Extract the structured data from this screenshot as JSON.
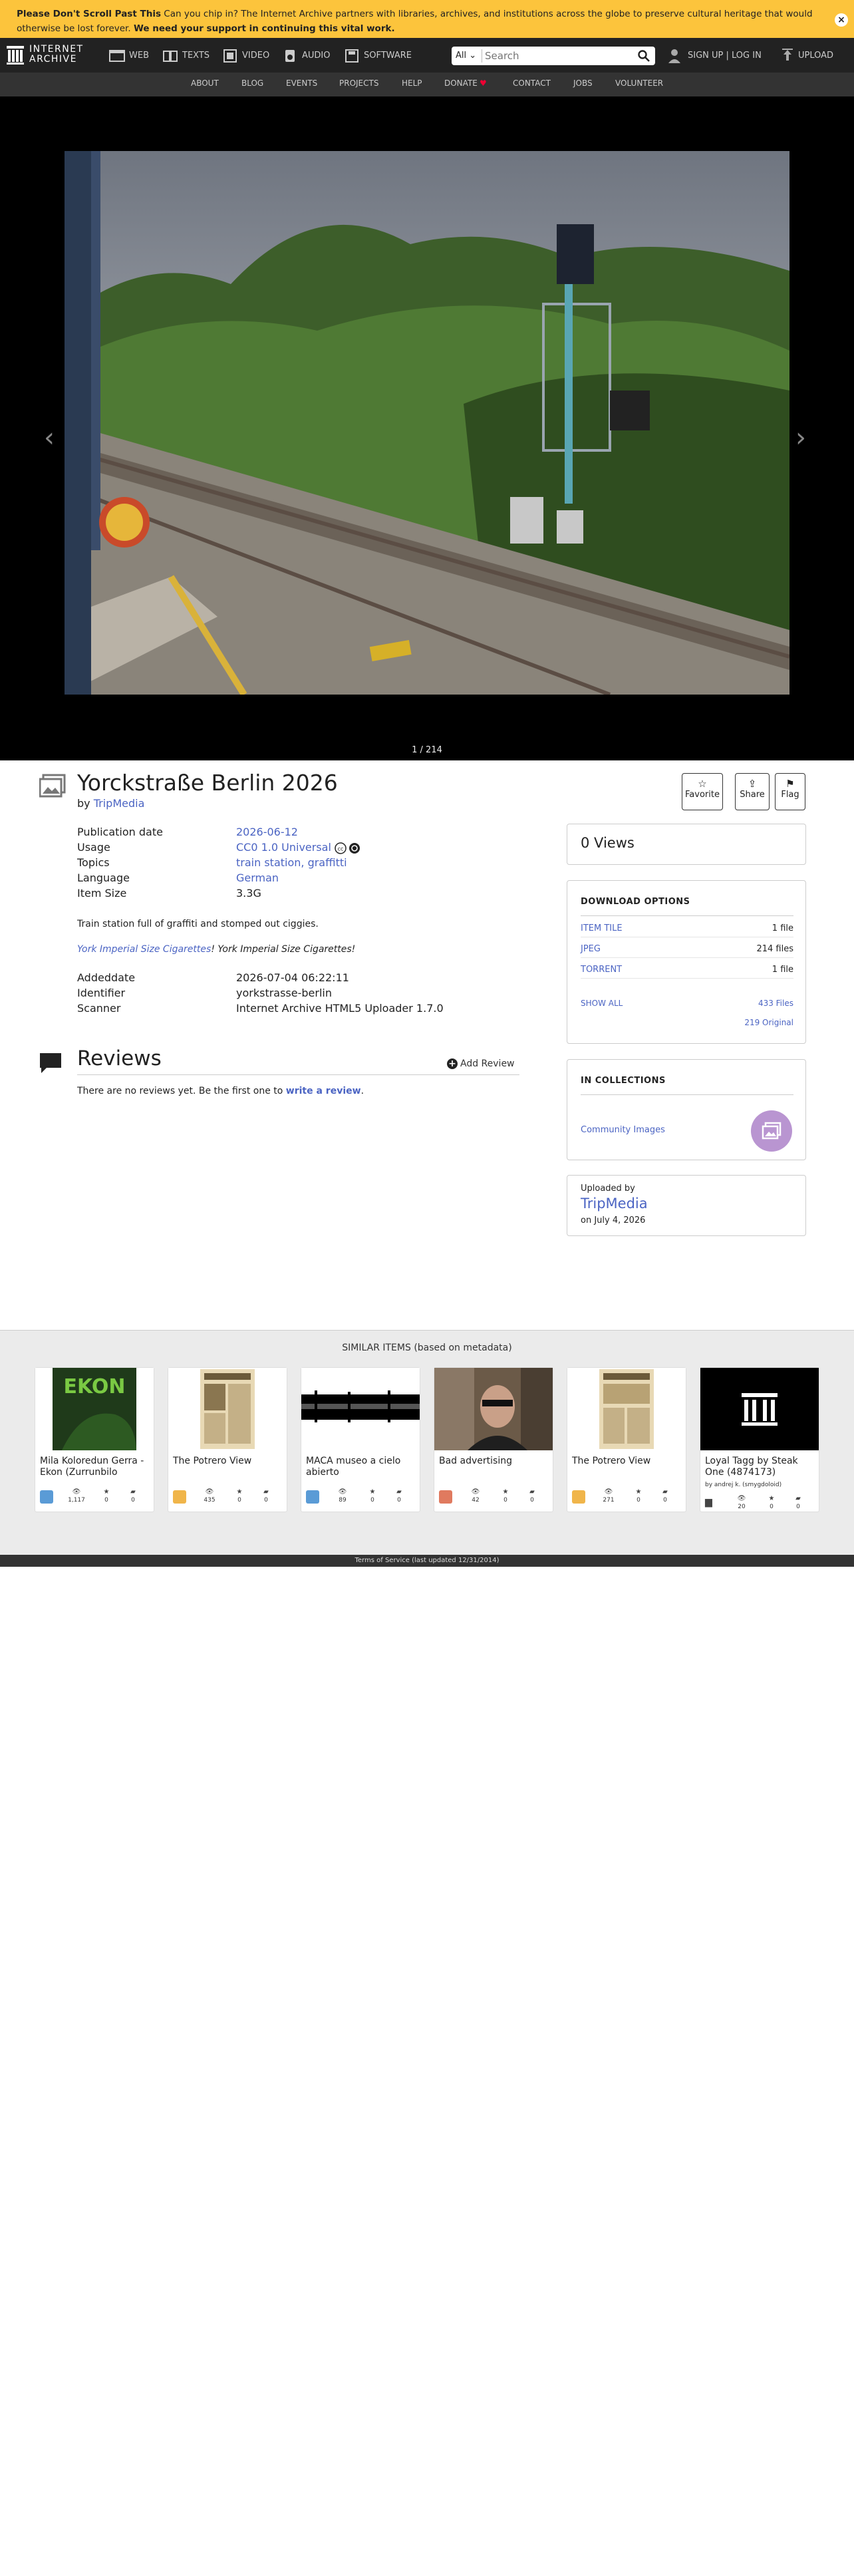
{
  "banner": {
    "bold_lead": "Please Don't Scroll Past This",
    "message": "Can you chip in? The Internet Archive partners with libraries, archives, and institutions across the globe to preserve cultural heritage that would otherwise be lost forever.",
    "bold_tail": "We need your support in continuing this vital work.",
    "close": "×"
  },
  "topnav": {
    "logo_line1": "INTERNET",
    "logo_line2": "ARCHIVE",
    "tabs": [
      "WEB",
      "TEXTS",
      "VIDEO",
      "AUDIO",
      "SOFTWARE"
    ],
    "search_scope": "All",
    "search_placeholder": "Search",
    "signup": "SIGN UP | LOG IN",
    "upload": "UPLOAD"
  },
  "subnav": [
    "ABOUT",
    "BLOG",
    "EVENTS",
    "PROJECTS",
    "HELP",
    "DONATE",
    "CONTACT",
    "JOBS",
    "VOLUNTEER"
  ],
  "theater": {
    "prev": "‹",
    "next": "›",
    "page_count": "1 / 214"
  },
  "item": {
    "title": "Yorckstraße Berlin 2026",
    "by_prefix": "by",
    "creator": "TripMedia",
    "actions": [
      {
        "glyph": "☆",
        "label": "Favorite"
      },
      {
        "glyph": "⇪",
        "label": "Share"
      },
      {
        "glyph": "⚑",
        "label": "Flag"
      }
    ],
    "meta": [
      {
        "key": "Publication date",
        "value": "2026-06-12"
      },
      {
        "key": "Usage",
        "value": "CC0 1.0 Universal"
      },
      {
        "key": "Topics",
        "value": "train station, graffitti"
      },
      {
        "key": "Language",
        "value": "German"
      },
      {
        "key": "Item Size",
        "value": "3.3G"
      }
    ],
    "description": "Train station full of graffiti and stomped out ciggies.",
    "quote_link": "York Imperial Size Cigarettes",
    "quote_rest": "! York Imperial Size Cigarettes!",
    "meta2": [
      {
        "key": "Addeddate",
        "value": "2026-07-04 06:22:11"
      },
      {
        "key": "Identifier",
        "value": "yorkstrasse-berlin"
      },
      {
        "key": "Scanner",
        "value": "Internet Archive HTML5 Uploader 1.7.0"
      }
    ]
  },
  "reviews": {
    "heading": "Reviews",
    "add": "Add Review",
    "empty_prefix": "There are no reviews yet. Be the first one to",
    "empty_link": "write a review",
    "empty_suffix": "."
  },
  "sidebar": {
    "views": "0 Views",
    "download_heading": "DOWNLOAD OPTIONS",
    "downloads": [
      {
        "label": "ITEM TILE",
        "count": "1 file"
      },
      {
        "label": "JPEG",
        "count": "214 files"
      },
      {
        "label": "TORRENT",
        "count": "1 file"
      }
    ],
    "show_all": "SHOW ALL",
    "files_total": "433 Files",
    "files_original": "219 Original",
    "collections_heading": "IN COLLECTIONS",
    "collection": "Community Images",
    "uploaded_by": "Uploaded by",
    "uploader": "TripMedia",
    "uploaded_on": "on July 4, 2026"
  },
  "similar": {
    "heading": "SIMILAR ITEMS (based on metadata)",
    "items": [
      {
        "title": "Mila Koloredun Gerra - Ekon (Zurrunbilo",
        "by": "",
        "views": "1,117",
        "favs": "0",
        "reviews": "0",
        "type": "audio"
      },
      {
        "title": "The Potrero View",
        "by": "",
        "views": "435",
        "favs": "0",
        "reviews": "0",
        "type": "texts"
      },
      {
        "title": "MACA museo a cielo abierto",
        "by": "",
        "views": "89",
        "favs": "0",
        "reviews": "0",
        "type": "audio"
      },
      {
        "title": "Bad advertising",
        "by": "",
        "views": "42",
        "favs": "0",
        "reviews": "0",
        "type": "movies"
      },
      {
        "title": "The Potrero View",
        "by": "",
        "views": "271",
        "favs": "0",
        "reviews": "0",
        "type": "texts"
      },
      {
        "title": "Loyal Tagg by Steak One (4874173)",
        "by": "by andrej k. (smygdoloid)",
        "views": "20",
        "favs": "0",
        "reviews": "0",
        "type": "collection"
      }
    ]
  },
  "footer": "Terms of Service (last updated 12/31/2014)",
  "colors": {
    "banner": "#fcc43c",
    "link": "#4b64c3",
    "nav": "#222222"
  }
}
